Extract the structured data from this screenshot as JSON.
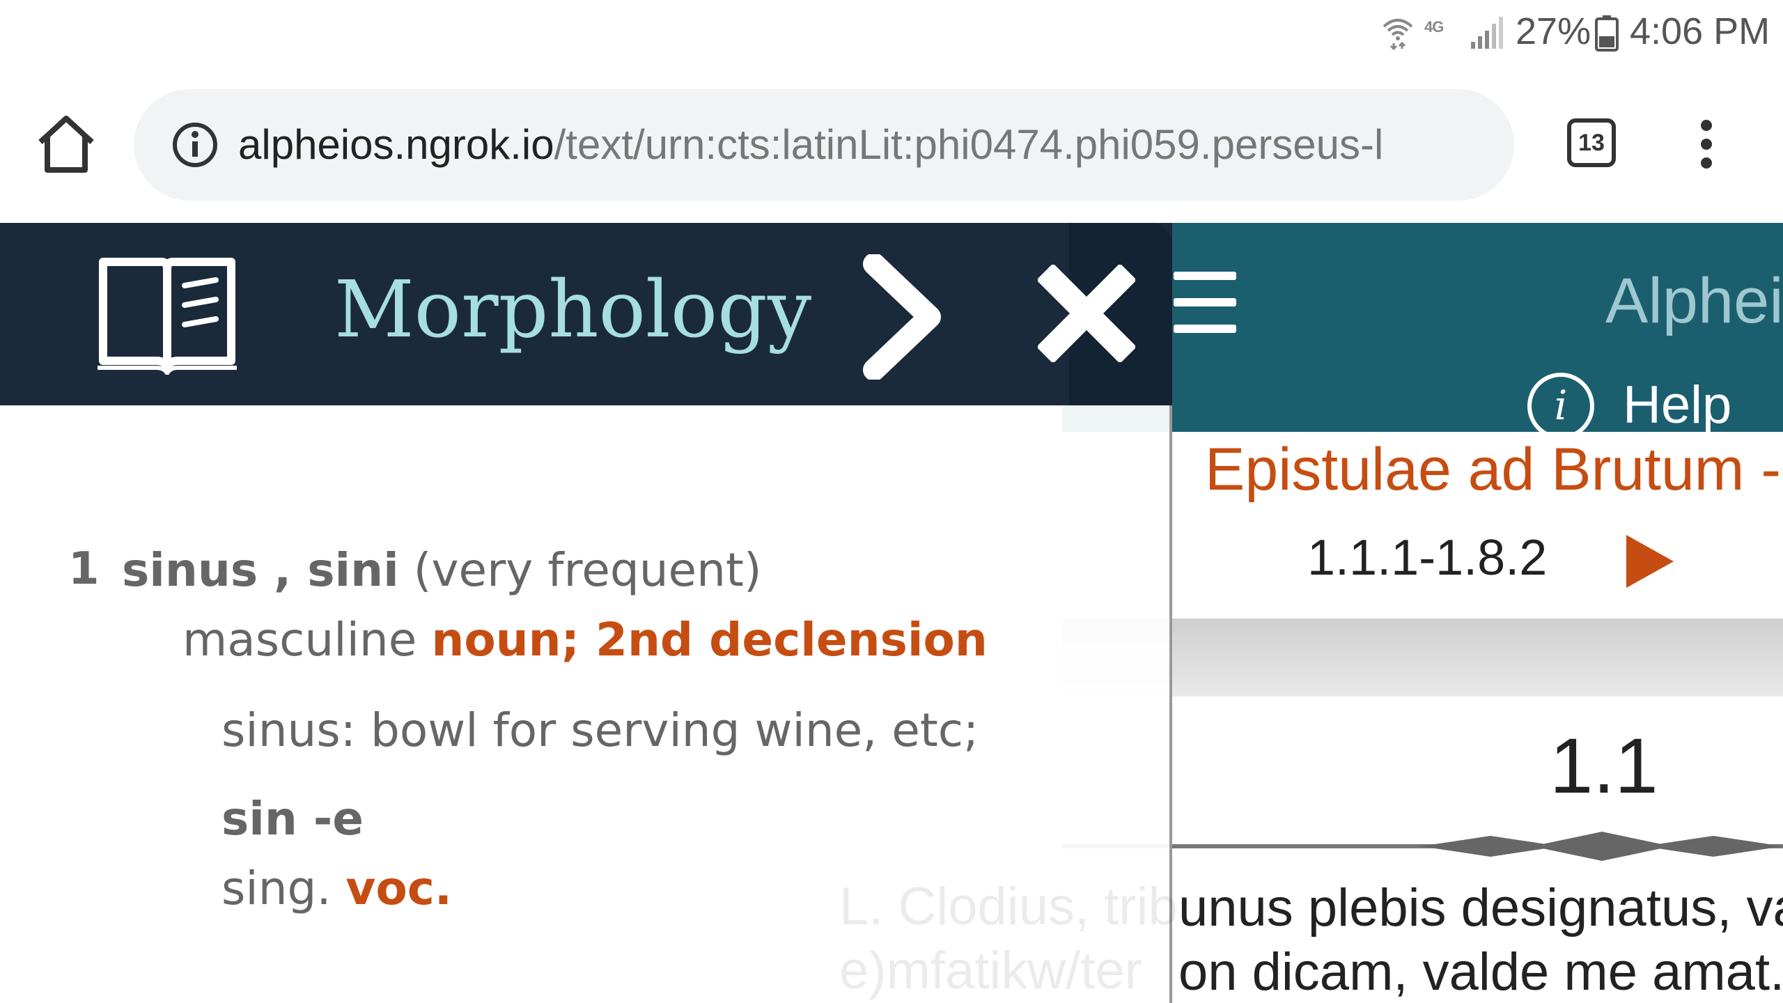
{
  "status_bar": {
    "network": "4G",
    "battery": "27%",
    "time": "4:06 PM"
  },
  "browser": {
    "url_host": "alpheios.ngrok.io",
    "url_path": "/text/urn:cts:latinLit:phi0474.phi059.perseus-l",
    "tab_count": "13"
  },
  "app": {
    "title": "Alphei",
    "help_label": "Help",
    "help_icon_glyph": "i",
    "document_title": "Epistulae ad Brutum -",
    "range": "1.1.1-1.8.2",
    "section": "1.1",
    "text_lines": [
      "unus plebis designatus, va",
      "on dicam, valde me amat."
    ],
    "faded_lines": [
      "L. Clodius, trib",
      "e)mfatikw/ter"
    ],
    "colors": {
      "header": "#1b5f6e",
      "accent": "#c64d12"
    }
  },
  "popup": {
    "title": "Morphology",
    "icons": [
      "book-icon",
      "chevron-right-icon",
      "close-icon"
    ],
    "lexeme": {
      "number": "1",
      "headword": "sinus , sini",
      "frequency": "(very frequent)",
      "gender": "masculine",
      "pos": "noun; 2nd declension",
      "definition": "sinus: bowl for serving wine, etc;",
      "inflection": "sin -e",
      "number_label": "sing.",
      "case_label": "voc."
    },
    "colors": {
      "header": "#1b2a3a",
      "title": "#a6dee3",
      "accent": "#c64d12"
    }
  }
}
